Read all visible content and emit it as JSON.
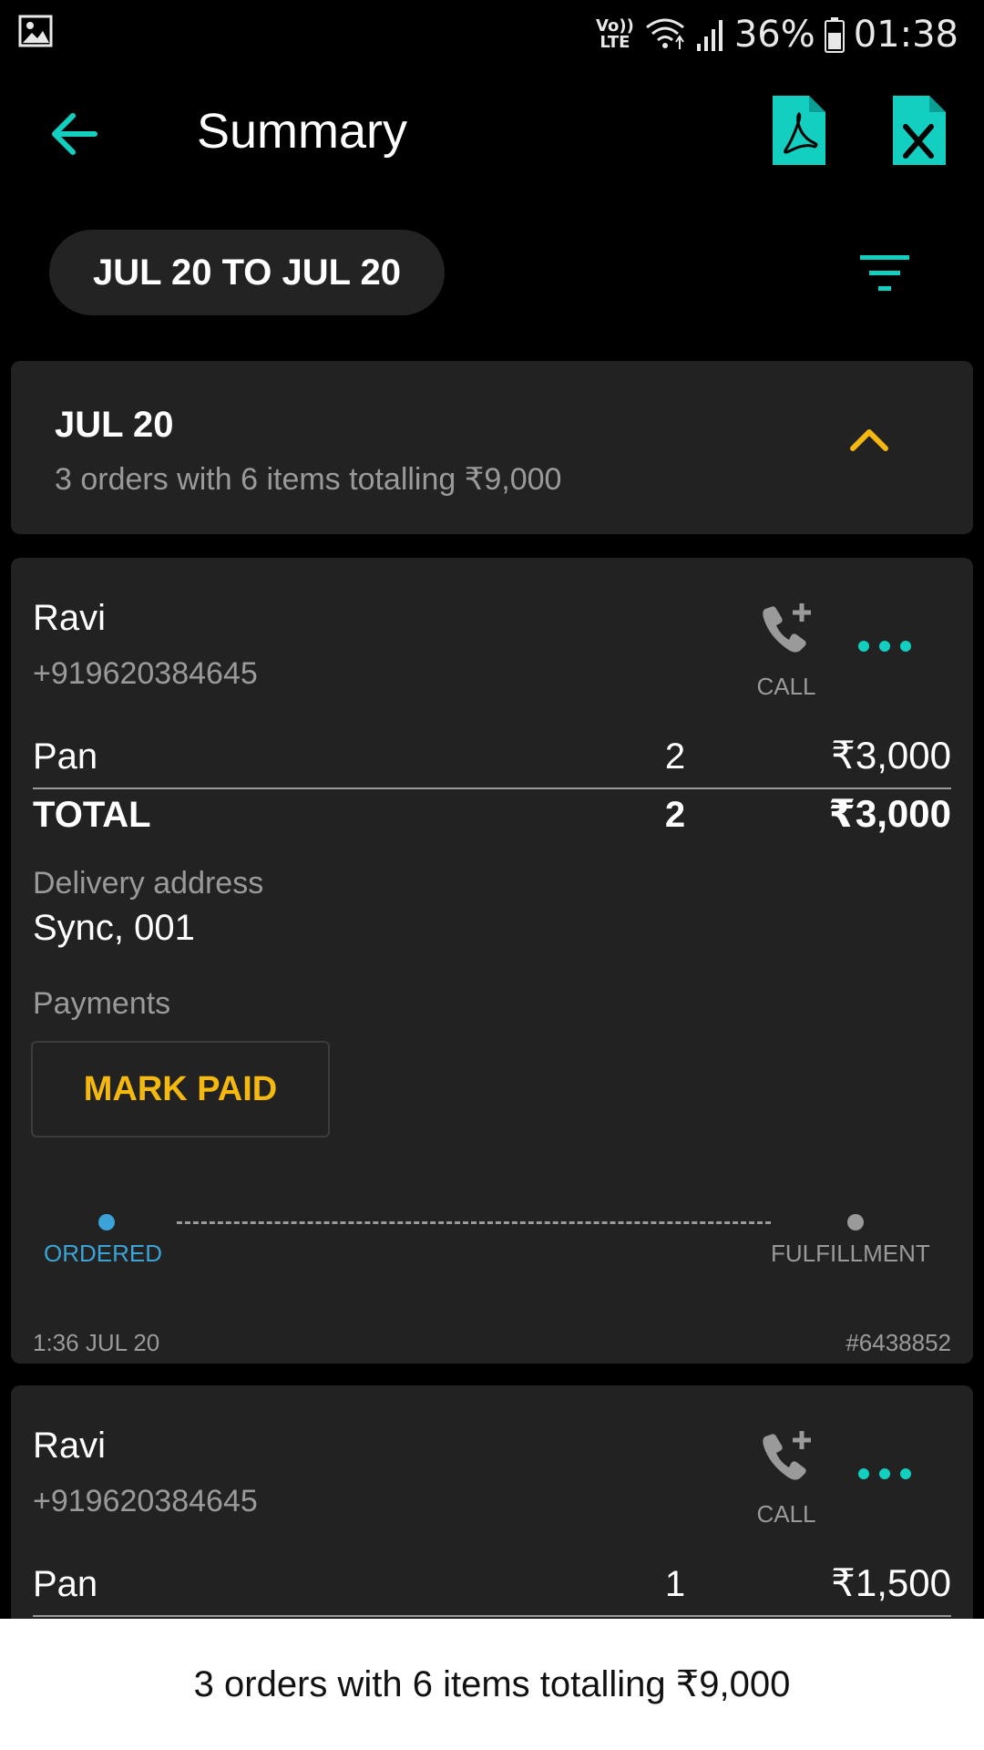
{
  "status_bar": {
    "volte_top": "Vo))",
    "volte_bottom": "LTE",
    "battery": "36%",
    "time": "01:38",
    "icons": [
      "gallery-icon",
      "wifi-icon",
      "signal-icon",
      "battery-icon"
    ]
  },
  "toolbar": {
    "title": "Summary",
    "icons": [
      "back-arrow-icon",
      "pdf-file-icon",
      "excel-file-icon"
    ]
  },
  "filter": {
    "date_range": "JUL 20 TO JUL 20",
    "icon": "filter-icon"
  },
  "day_group": {
    "date": "JUL 20",
    "summary": "3 orders with 6 items totalling ₹9,000"
  },
  "orders": [
    {
      "customer": "Ravi",
      "phone": "+919620384645",
      "call_label": "CALL",
      "items": [
        {
          "name": "Pan",
          "qty": "2",
          "amount": "₹3,000"
        }
      ],
      "total": {
        "label": "TOTAL",
        "qty": "2",
        "amount": "₹3,000"
      },
      "delivery_label": "Delivery address",
      "delivery_address": "Sync, 001",
      "payments_label": "Payments",
      "mark_paid": "MARK PAID",
      "steps": [
        "ORDERED",
        "FULFILLMENT"
      ],
      "timestamp": "1:36 JUL 20",
      "order_id": "#6438852"
    },
    {
      "customer": "Ravi",
      "phone": "+919620384645",
      "call_label": "CALL",
      "items": [
        {
          "name": "Pan",
          "qty": "1",
          "amount": "₹1,500"
        }
      ]
    }
  ],
  "bottom_bar": {
    "summary": "3 orders with 6 items totalling ₹9,000"
  },
  "colors": {
    "accent": "#12cfc0",
    "warning": "#f5b80e",
    "step_active": "#3ba3d8",
    "card": "#222222"
  }
}
